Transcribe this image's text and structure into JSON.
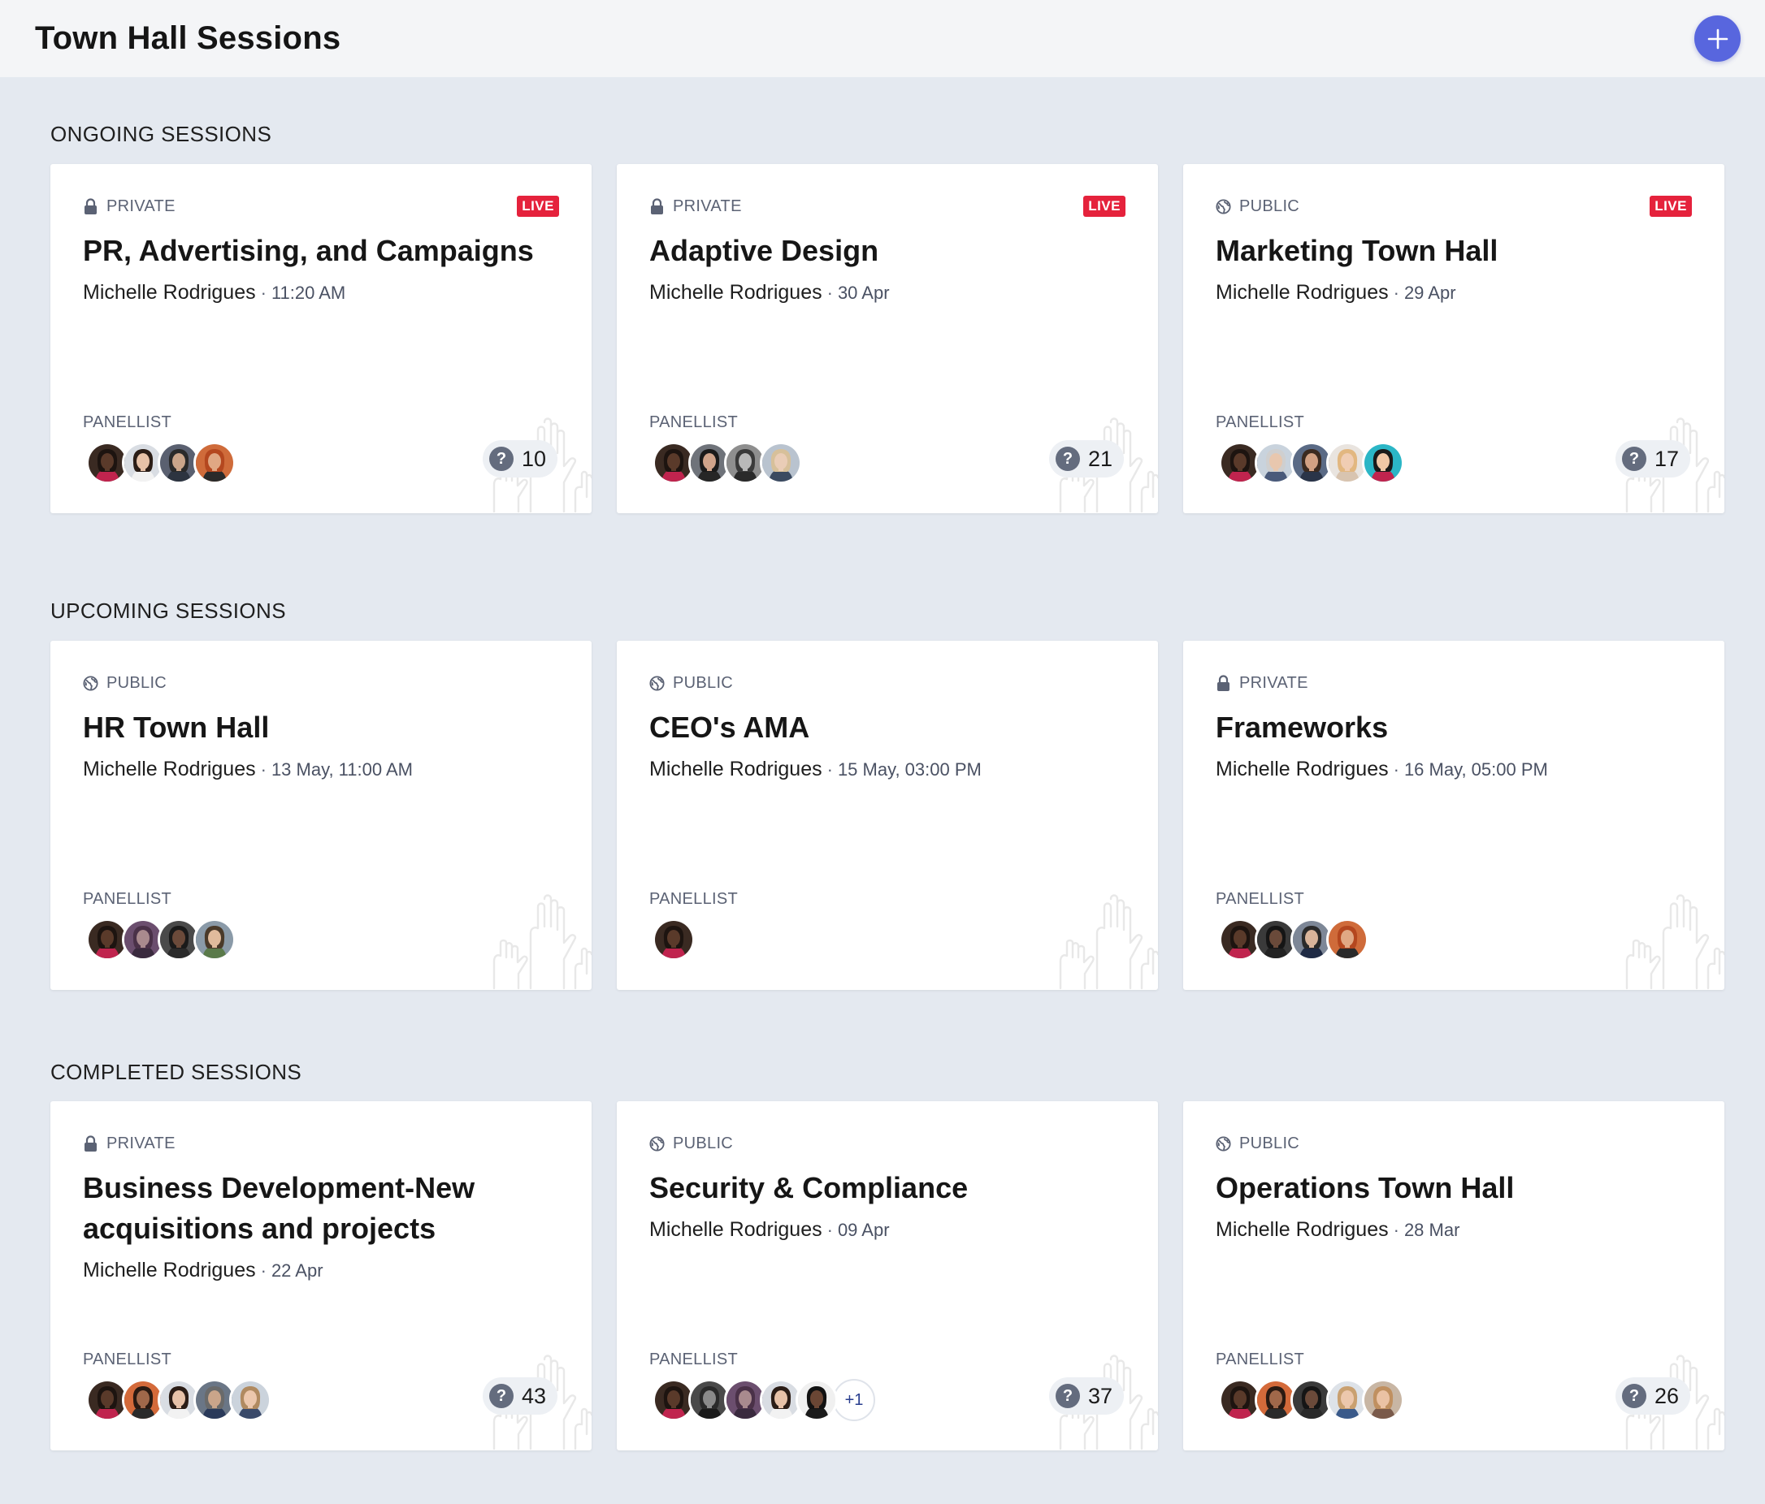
{
  "header": {
    "title": "Town Hall Sessions",
    "add_icon": "plus-icon"
  },
  "colors": {
    "accent": "#5866de",
    "live": "#e5223c",
    "background": "#e4e9f0"
  },
  "sections": [
    {
      "title": "ONGOING SESSIONS",
      "cards": [
        {
          "visibility": "PRIVATE",
          "icon": "lock-icon",
          "live": "LIVE",
          "title": "PR, Advertising, and Campaigns",
          "host": "Michelle Rodrigues",
          "when": "11:20 AM",
          "panel_label": "PANELLIST",
          "questions": "10",
          "avatars": [
            {
              "skin": "#5a3a2a",
              "hair": "#1d1410",
              "bg": "#3a2a22",
              "shirt": "#c0244e"
            },
            {
              "skin": "#e7c2a8",
              "hair": "#2b1d16",
              "bg": "#d9dde3",
              "shirt": "#f2f2f2"
            },
            {
              "skin": "#caa58a",
              "hair": "#2a2a2a",
              "bg": "#5a6070",
              "shirt": "#2d3440"
            },
            {
              "skin": "#e0a884",
              "hair": "#b4471f",
              "bg": "#cf6b3a",
              "shirt": "#2a2a2a"
            }
          ]
        },
        {
          "visibility": "PRIVATE",
          "icon": "lock-icon",
          "live": "LIVE",
          "title": "Adaptive Design",
          "host": "Michelle Rodrigues",
          "when": "30 Apr",
          "panel_label": "PANELLIST",
          "questions": "21",
          "avatars": [
            {
              "skin": "#5a3a2a",
              "hair": "#1d1410",
              "bg": "#3a2a22",
              "shirt": "#c0244e"
            },
            {
              "skin": "#cfa38a",
              "hair": "#1a1a1a",
              "bg": "#6f737a",
              "shirt": "#262626"
            },
            {
              "skin": "#b9b9b9",
              "hair": "#3a3a3a",
              "bg": "#8e8e8e",
              "shirt": "#2a2a2a"
            },
            {
              "skin": "#eacdb7",
              "hair": "#d7c09a",
              "bg": "#b9c3cf",
              "shirt": "#3b4a60"
            }
          ]
        },
        {
          "visibility": "PUBLIC",
          "icon": "globe-icon",
          "live": "LIVE",
          "title": "Marketing Town Hall",
          "host": "Michelle Rodrigues",
          "when": "29 Apr",
          "panel_label": "PANELLIST",
          "questions": "17",
          "avatars": [
            {
              "skin": "#5a3a2a",
              "hair": "#1d1410",
              "bg": "#3a2a22",
              "shirt": "#c0244e"
            },
            {
              "skin": "#e8c7ae",
              "hair": "#cfcfcf",
              "bg": "#c9d3dd",
              "shirt": "#4a5a7a"
            },
            {
              "skin": "#d2a184",
              "hair": "#3b2a20",
              "bg": "#5a6a85",
              "shirt": "#2a3448"
            },
            {
              "skin": "#f0cdb3",
              "hair": "#e2b780",
              "bg": "#e9e4df",
              "shirt": "#d8c4b0"
            },
            {
              "skin": "#f1c7a6",
              "hair": "#1a1a1a",
              "bg": "#2bb6c6",
              "shirt": "#c0244e"
            }
          ]
        }
      ]
    },
    {
      "title": "UPCOMING SESSIONS",
      "cards": [
        {
          "visibility": "PUBLIC",
          "icon": "globe-icon",
          "live": "",
          "title": "HR Town Hall",
          "host": "Michelle Rodrigues",
          "when": "13 May, 11:00 AM",
          "panel_label": "PANELLIST",
          "questions": "",
          "avatars": [
            {
              "skin": "#5a3a2a",
              "hair": "#1d1410",
              "bg": "#3a2a22",
              "shirt": "#c0244e"
            },
            {
              "skin": "#a98a8e",
              "hair": "#4a3148",
              "bg": "#6b4e6e",
              "shirt": "#3a2a3e"
            },
            {
              "skin": "#6b4a3a",
              "hair": "#1a1a1a",
              "bg": "#4a4a4a",
              "shirt": "#2a2a2a"
            },
            {
              "skin": "#e0bb9c",
              "hair": "#4a3a2a",
              "bg": "#8a9aa8",
              "shirt": "#5a7a4a"
            }
          ]
        },
        {
          "visibility": "PUBLIC",
          "icon": "globe-icon",
          "live": "",
          "title": "CEO's AMA",
          "host": "Michelle Rodrigues",
          "when": "15 May, 03:00 PM",
          "panel_label": "PANELLIST",
          "questions": "",
          "avatars": [
            {
              "skin": "#5a3a2a",
              "hair": "#1d1410",
              "bg": "#3a2a22",
              "shirt": "#c0244e"
            }
          ]
        },
        {
          "visibility": "PRIVATE",
          "icon": "lock-icon",
          "live": "",
          "title": "Frameworks",
          "host": "Michelle Rodrigues",
          "when": "16 May, 05:00 PM",
          "panel_label": "PANELLIST",
          "questions": "",
          "avatars": [
            {
              "skin": "#5a3a2a",
              "hair": "#1d1410",
              "bg": "#3a2a22",
              "shirt": "#c0244e"
            },
            {
              "skin": "#6a4a3a",
              "hair": "#151515",
              "bg": "#3a3a3a",
              "shirt": "#222"
            },
            {
              "skin": "#d9b49a",
              "hair": "#2a2a2a",
              "bg": "#7d8797",
              "shirt": "#1e2a44"
            },
            {
              "skin": "#e0a884",
              "hair": "#b4471f",
              "bg": "#cf6b3a",
              "shirt": "#2a2a2a"
            }
          ]
        }
      ]
    },
    {
      "title": "COMPLETED SESSIONS",
      "cards": [
        {
          "visibility": "PRIVATE",
          "icon": "lock-icon",
          "live": "",
          "title": "Business Development-New acquisitions and projects",
          "host": "Michelle Rodrigues",
          "when": "22 Apr",
          "panel_label": "PANELLIST",
          "questions": "43",
          "avatars": [
            {
              "skin": "#5a3a2a",
              "hair": "#1d1410",
              "bg": "#3a2a22",
              "shirt": "#c0244e"
            },
            {
              "skin": "#a0684a",
              "hair": "#2a1a12",
              "bg": "#d46a3a",
              "shirt": "#2a2a2a"
            },
            {
              "skin": "#e7c2a8",
              "hair": "#2b1d16",
              "bg": "#d9dde3",
              "shirt": "#f2f2f2"
            },
            {
              "skin": "#caa58a",
              "hair": "#6a6a6a",
              "bg": "#6a7686",
              "shirt": "#2a3a5a"
            },
            {
              "skin": "#ecc7ac",
              "hair": "#b08a60",
              "bg": "#cbd3dc",
              "shirt": "#3a4a6a"
            }
          ]
        },
        {
          "visibility": "PUBLIC",
          "icon": "globe-icon",
          "live": "",
          "title": "Security & Compliance",
          "host": "Michelle Rodrigues",
          "when": "09 Apr",
          "panel_label": "PANELLIST",
          "questions": "37",
          "more": "+1",
          "avatars": [
            {
              "skin": "#5a3a2a",
              "hair": "#1d1410",
              "bg": "#3a2a22",
              "shirt": "#c0244e"
            },
            {
              "skin": "#8a8a8a",
              "hair": "#2a2a2a",
              "bg": "#4a4a4a",
              "shirt": "#1a1a1a"
            },
            {
              "skin": "#a98a8e",
              "hair": "#4a3148",
              "bg": "#6b4e6e",
              "shirt": "#3a2a3e"
            },
            {
              "skin": "#e7c2a8",
              "hair": "#2b1d16",
              "bg": "#d9dde3",
              "shirt": "#f2f2f2"
            },
            {
              "skin": "#6a4634",
              "hair": "#121212",
              "bg": "#f0f0f0",
              "shirt": "#1a1a1a"
            }
          ]
        },
        {
          "visibility": "PUBLIC",
          "icon": "globe-icon",
          "live": "",
          "title": "Operations Town Hall",
          "host": "Michelle Rodrigues",
          "when": "28 Mar",
          "panel_label": "PANELLIST",
          "questions": "26",
          "avatars": [
            {
              "skin": "#5a3a2a",
              "hair": "#1d1410",
              "bg": "#3a2a22",
              "shirt": "#c0244e"
            },
            {
              "skin": "#a0684a",
              "hair": "#2a1a12",
              "bg": "#d46a3a",
              "shirt": "#2a2a2a"
            },
            {
              "skin": "#6b4a3a",
              "hair": "#151515",
              "bg": "#3a3a3a",
              "shirt": "#2a2a2a"
            },
            {
              "skin": "#ecc7ac",
              "hair": "#c9a070",
              "bg": "#dde2e8",
              "shirt": "#3a5a8a"
            },
            {
              "skin": "#eac2a4",
              "hair": "#c09060",
              "bg": "#c8b6a4",
              "shirt": "#7a5a4a"
            }
          ]
        }
      ]
    }
  ]
}
